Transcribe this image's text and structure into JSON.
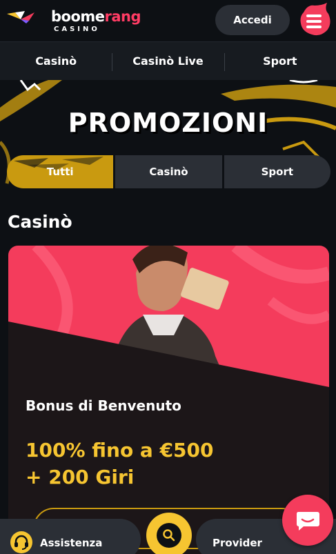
{
  "header": {
    "logo_word_1": "boome",
    "logo_word_2": "rang",
    "logo_sub": "CASINO",
    "login_label": "Accedi"
  },
  "nav": {
    "tabs": [
      "Casinò",
      "Casinò Live",
      "Sport"
    ]
  },
  "hero": {
    "title": "PROMOZIONI"
  },
  "filters": {
    "items": [
      "Tutti",
      "Casinò",
      "Sport"
    ],
    "active": "Tutti"
  },
  "section": {
    "title": "Casinò"
  },
  "promo": {
    "title": "Bonus di Benvenuto",
    "offer_line_1": "100% fino a €500",
    "offer_line_2": "+ 200 Giri"
  },
  "bottom_bar": {
    "support_label": "Assistenza",
    "provider_label": "Provider"
  },
  "colors": {
    "background": "#0d1014",
    "accent_gold": "#f6c531",
    "accent_pink": "#f43c5c",
    "surface": "#2b2f36"
  },
  "icons": {
    "logo": "boomerang-logo-icon",
    "menu": "menu-icon",
    "support": "headset-icon",
    "search": "search-icon",
    "chat": "chat-icon"
  }
}
